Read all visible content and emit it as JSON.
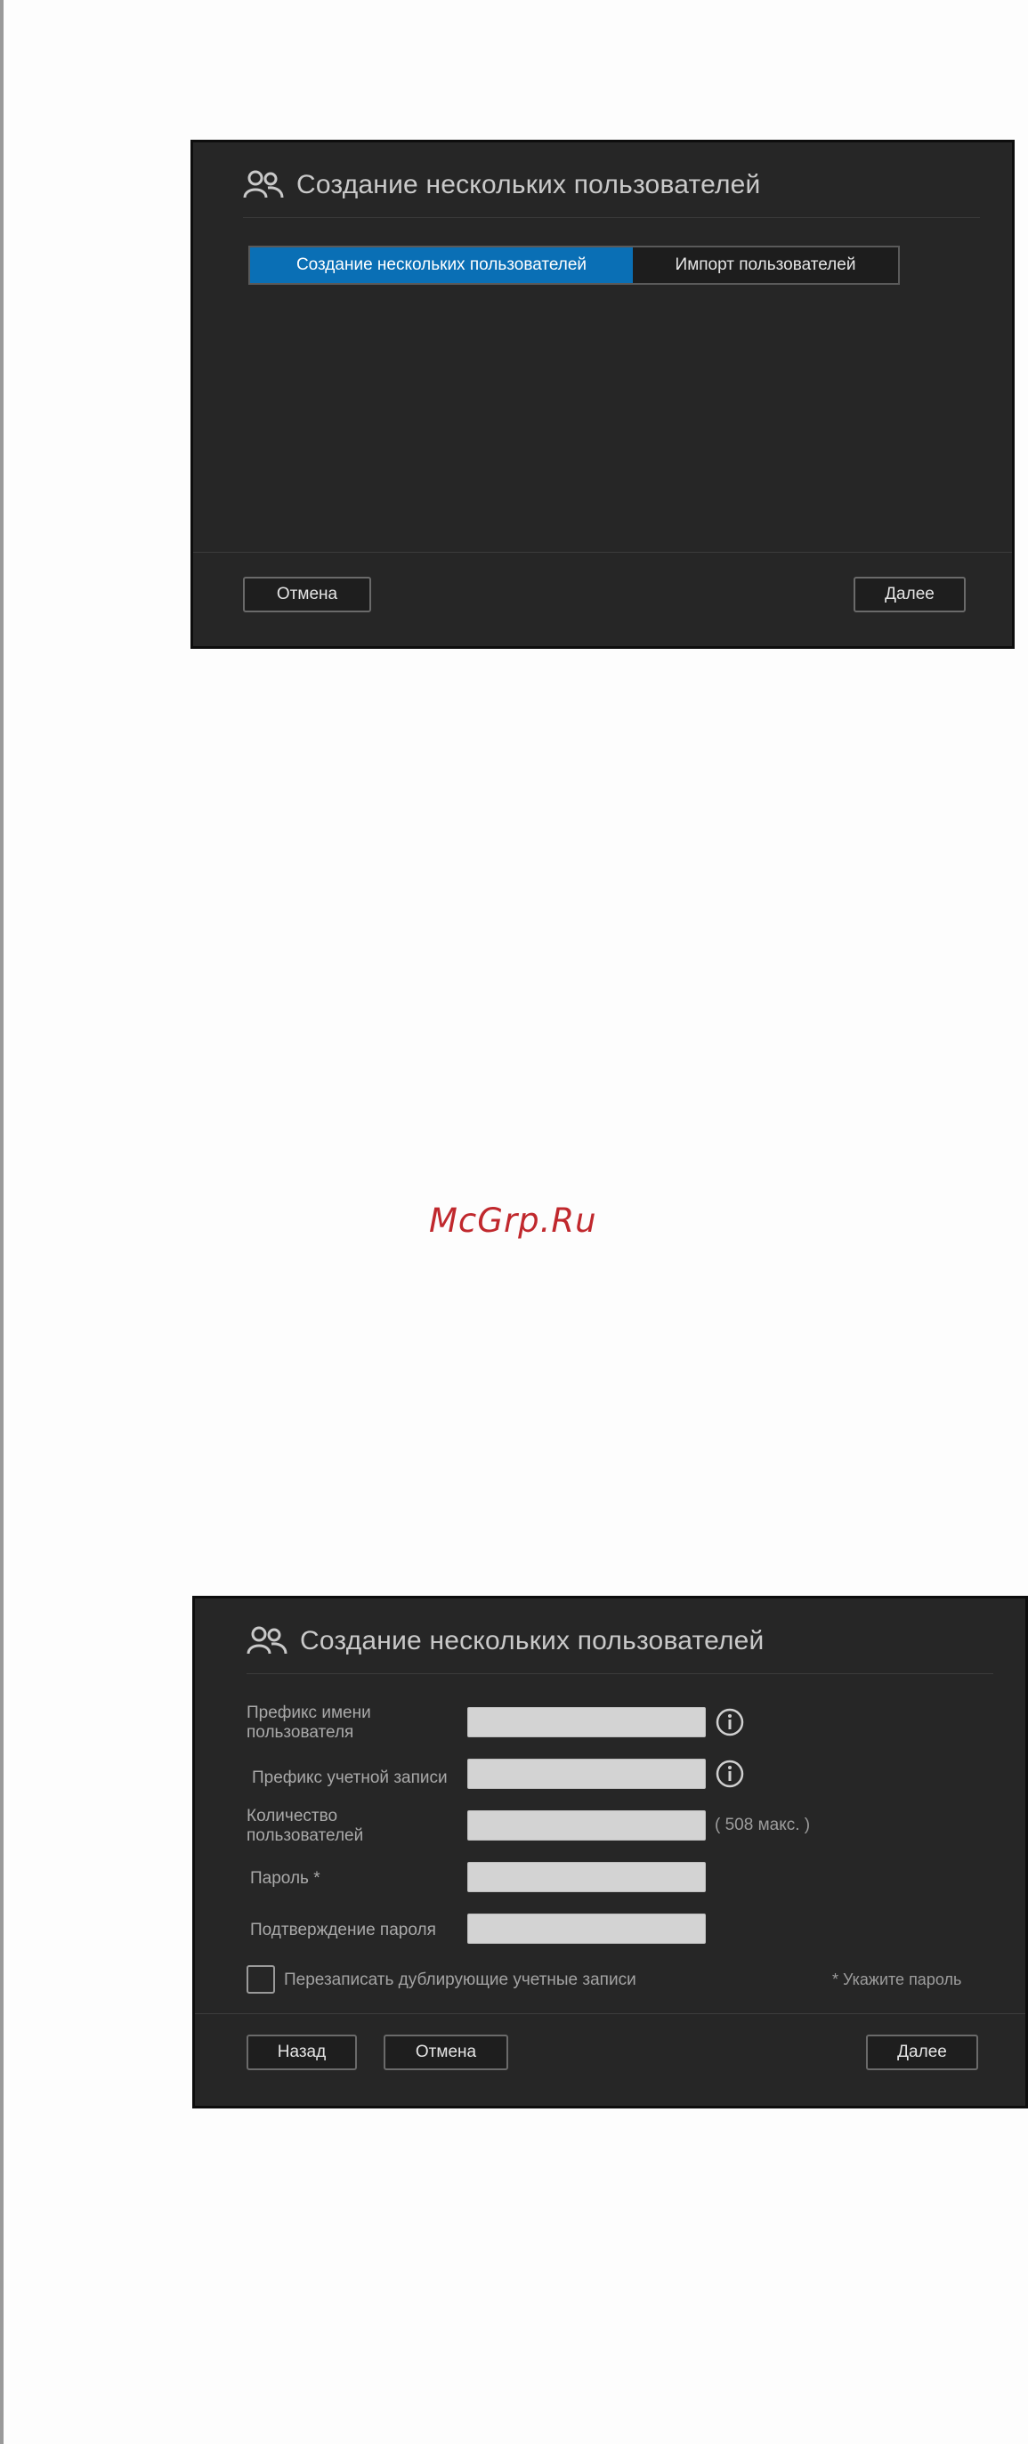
{
  "dialog1": {
    "title": "Создание нескольких пользователей",
    "tabs": [
      {
        "label": "Создание нескольких пользователей",
        "active": true
      },
      {
        "label": "Импорт пользователей",
        "active": false
      }
    ],
    "cancel_label": "Отмена",
    "next_label": "Далее"
  },
  "watermark": "McGrp.Ru",
  "dialog2": {
    "title": "Создание нескольких пользователей",
    "fields": [
      {
        "label": "Префикс имени пользователя",
        "value": ""
      },
      {
        "label": "Префикс учетной записи",
        "value": ""
      },
      {
        "label": "Количество пользователей",
        "value": "",
        "hint": "( 508 макс. )"
      },
      {
        "label": "Пароль *",
        "value": ""
      },
      {
        "label": "Подтверждение пароля",
        "value": ""
      }
    ],
    "overwrite_label": "Перезаписать дублирующие учетные записи",
    "overwrite_checked": false,
    "required_note": "* Укажите пароль",
    "back_label": "Назад",
    "cancel_label": "Отмена",
    "next_label": "Далее"
  },
  "colors": {
    "dialog_bg": "#262626",
    "accent": "#0a6fb5",
    "input_bg": "#d3d3d3",
    "watermark": "#c0282d"
  }
}
